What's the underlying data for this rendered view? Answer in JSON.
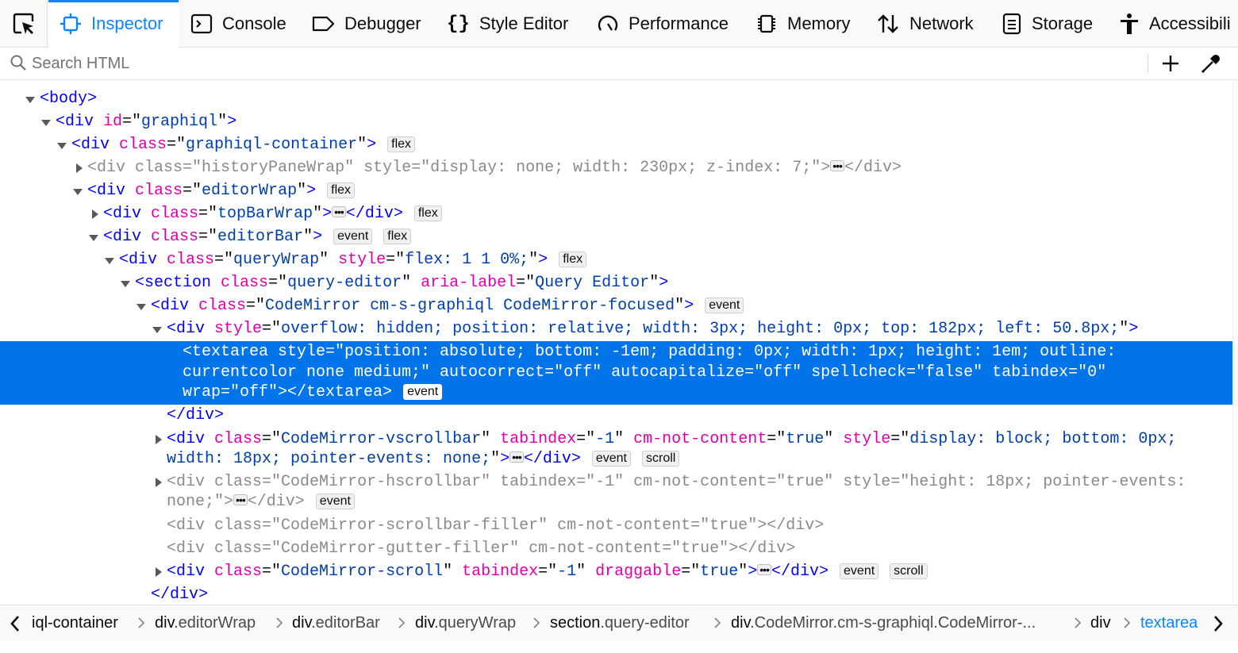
{
  "toolbar": {
    "tabs": [
      {
        "label": "Inspector",
        "icon": "inspector-icon"
      },
      {
        "label": "Console",
        "icon": "console-icon"
      },
      {
        "label": "Debugger",
        "icon": "debugger-icon"
      },
      {
        "label": "Style Editor",
        "icon": "style-editor-icon"
      },
      {
        "label": "Performance",
        "icon": "performance-icon"
      },
      {
        "label": "Memory",
        "icon": "memory-icon"
      },
      {
        "label": "Network",
        "icon": "network-icon"
      },
      {
        "label": "Storage",
        "icon": "storage-icon"
      },
      {
        "label": "Accessibili",
        "icon": "accessibility-icon"
      }
    ],
    "accent": "#0a84ff"
  },
  "search": {
    "placeholder": "Search HTML"
  },
  "tree": {
    "selection_color": "#0074e8",
    "lines": [
      {
        "segments": [
          [
            "tg",
            "<body>"
          ]
        ]
      },
      {
        "segments": [
          [
            "tg",
            "<div "
          ],
          [
            "an",
            "id"
          ],
          [
            "tx",
            "=\""
          ],
          [
            "av",
            "graphiql"
          ],
          [
            "tx",
            "\""
          ],
          [
            "tg",
            ">"
          ]
        ]
      },
      {
        "segments": [
          [
            "tg",
            "<div "
          ],
          [
            "an",
            "class"
          ],
          [
            "tx",
            "=\""
          ],
          [
            "av",
            "graphiql-container"
          ],
          [
            "tx",
            "\""
          ],
          [
            "tg",
            ">"
          ]
        ],
        "badges": [
          "flex"
        ]
      },
      {
        "segments": [
          [
            "tg",
            "<div "
          ],
          [
            "an",
            "class"
          ],
          [
            "tx",
            "=\""
          ],
          [
            "av",
            "historyPaneWrap"
          ],
          [
            "tx",
            "\" "
          ],
          [
            "an",
            "style"
          ],
          [
            "tx",
            "=\""
          ],
          [
            "av",
            "display: none; width: 230px; z-index: 7;"
          ],
          [
            "tx",
            "\""
          ],
          [
            "tg",
            ">"
          ]
        ],
        "tail": "</div>"
      },
      {
        "segments": [
          [
            "tg",
            "<div "
          ],
          [
            "an",
            "class"
          ],
          [
            "tx",
            "=\""
          ],
          [
            "av",
            "editorWrap"
          ],
          [
            "tx",
            "\""
          ],
          [
            "tg",
            ">"
          ]
        ],
        "badges": [
          "flex"
        ]
      },
      {
        "segments": [
          [
            "tg",
            "<div "
          ],
          [
            "an",
            "class"
          ],
          [
            "tx",
            "=\""
          ],
          [
            "av",
            "topBarWrap"
          ],
          [
            "tx",
            "\""
          ],
          [
            "tg",
            ">"
          ]
        ],
        "tail": "</div>",
        "badges": [
          "flex"
        ]
      },
      {
        "segments": [
          [
            "tg",
            "<div "
          ],
          [
            "an",
            "class"
          ],
          [
            "tx",
            "=\""
          ],
          [
            "av",
            "editorBar"
          ],
          [
            "tx",
            "\""
          ],
          [
            "tg",
            ">"
          ]
        ],
        "badges": [
          "event",
          "flex"
        ]
      },
      {
        "segments": [
          [
            "tg",
            "<div "
          ],
          [
            "an",
            "class"
          ],
          [
            "tx",
            "=\""
          ],
          [
            "av",
            "queryWrap"
          ],
          [
            "tx",
            "\" "
          ],
          [
            "an",
            "style"
          ],
          [
            "tx",
            "=\""
          ],
          [
            "av",
            "flex: 1 1 0%;"
          ],
          [
            "tx",
            "\""
          ],
          [
            "tg",
            ">"
          ]
        ],
        "badges": [
          "flex"
        ]
      },
      {
        "segments": [
          [
            "tg",
            "<section "
          ],
          [
            "an",
            "class"
          ],
          [
            "tx",
            "=\""
          ],
          [
            "av",
            "query-editor"
          ],
          [
            "tx",
            "\" "
          ],
          [
            "an",
            "aria-label"
          ],
          [
            "tx",
            "=\""
          ],
          [
            "av",
            "Query Editor"
          ],
          [
            "tx",
            "\""
          ],
          [
            "tg",
            ">"
          ]
        ]
      },
      {
        "segments": [
          [
            "tg",
            "<div "
          ],
          [
            "an",
            "class"
          ],
          [
            "tx",
            "=\""
          ],
          [
            "av",
            "CodeMirror cm-s-graphiql CodeMirror-focused"
          ],
          [
            "tx",
            "\""
          ],
          [
            "tg",
            ">"
          ]
        ],
        "badges": [
          "event"
        ]
      },
      {
        "segments": [
          [
            "tg",
            "<div "
          ],
          [
            "an",
            "style"
          ],
          [
            "tx",
            "=\""
          ],
          [
            "av",
            "overflow: hidden; position: relative; width: 3px; height: 0px; top: 182px; left: 50.8px;"
          ],
          [
            "tx",
            "\""
          ],
          [
            "tg",
            ">"
          ]
        ]
      },
      {
        "lines": [
          "<textarea style=\"position: absolute; bottom: -1em; padding: 0px; width: 1px; height: 1em; outline:",
          "currentcolor none medium;\" autocorrect=\"off\" autocapitalize=\"off\" spellcheck=\"false\" tabindex=\"0\"",
          "wrap=\"off\"></textarea>"
        ],
        "badges": [
          "event"
        ]
      },
      {
        "segments": [
          [
            "tg",
            "</div>"
          ]
        ]
      },
      {
        "segments": [
          [
            "tg",
            "<div "
          ],
          [
            "an",
            "class"
          ],
          [
            "tx",
            "=\""
          ],
          [
            "av",
            "CodeMirror-vscrollbar"
          ],
          [
            "tx",
            "\" "
          ],
          [
            "an",
            "tabindex"
          ],
          [
            "tx",
            "=\""
          ],
          [
            "av",
            "-1"
          ],
          [
            "tx",
            "\" "
          ],
          [
            "an",
            "cm-not-content"
          ],
          [
            "tx",
            "=\""
          ],
          [
            "av",
            "true"
          ],
          [
            "tx",
            "\" "
          ],
          [
            "an",
            "style"
          ],
          [
            "tx",
            "=\""
          ],
          [
            "av",
            "display: block; bottom: 0px;"
          ]
        ],
        "segments2": [
          [
            "av",
            "width: 18px; pointer-events: none;"
          ],
          [
            "tx",
            "\""
          ],
          [
            "tg",
            ">"
          ]
        ],
        "tail": "</div>",
        "badges": [
          "event",
          "scroll"
        ]
      },
      {
        "segments": [
          [
            "tg",
            "<div "
          ],
          [
            "an",
            "class"
          ],
          [
            "tx",
            "=\""
          ],
          [
            "av",
            "CodeMirror-hscrollbar"
          ],
          [
            "tx",
            "\" "
          ],
          [
            "an",
            "tabindex"
          ],
          [
            "tx",
            "=\""
          ],
          [
            "av",
            "-1"
          ],
          [
            "tx",
            "\" "
          ],
          [
            "an",
            "cm-not-content"
          ],
          [
            "tx",
            "=\""
          ],
          [
            "av",
            "true"
          ],
          [
            "tx",
            "\" "
          ],
          [
            "an",
            "style"
          ],
          [
            "tx",
            "=\""
          ],
          [
            "av",
            "height: 18px; pointer-events:"
          ]
        ],
        "segments2": [
          [
            "av",
            "none;"
          ],
          [
            "tx",
            "\""
          ],
          [
            "tg",
            ">"
          ]
        ],
        "tail": "</div>",
        "badges": [
          "event"
        ]
      },
      {
        "segments": [
          [
            "tg",
            "<div "
          ],
          [
            "an",
            "class"
          ],
          [
            "tx",
            "=\""
          ],
          [
            "av",
            "CodeMirror-scrollbar-filler"
          ],
          [
            "tx",
            "\" "
          ],
          [
            "an",
            "cm-not-content"
          ],
          [
            "tx",
            "=\""
          ],
          [
            "av",
            "true"
          ],
          [
            "tx",
            "\""
          ],
          [
            "tg",
            "></div>"
          ]
        ]
      },
      {
        "segments": [
          [
            "tg",
            "<div "
          ],
          [
            "an",
            "class"
          ],
          [
            "tx",
            "=\""
          ],
          [
            "av",
            "CodeMirror-gutter-filler"
          ],
          [
            "tx",
            "\" "
          ],
          [
            "an",
            "cm-not-content"
          ],
          [
            "tx",
            "=\""
          ],
          [
            "av",
            "true"
          ],
          [
            "tx",
            "\""
          ],
          [
            "tg",
            "></div>"
          ]
        ]
      },
      {
        "segments": [
          [
            "tg",
            "<div "
          ],
          [
            "an",
            "class"
          ],
          [
            "tx",
            "=\""
          ],
          [
            "av",
            "CodeMirror-scroll"
          ],
          [
            "tx",
            "\" "
          ],
          [
            "an",
            "tabindex"
          ],
          [
            "tx",
            "=\""
          ],
          [
            "av",
            "-1"
          ],
          [
            "tx",
            "\" "
          ],
          [
            "an",
            "draggable"
          ],
          [
            "tx",
            "=\""
          ],
          [
            "av",
            "true"
          ],
          [
            "tx",
            "\""
          ],
          [
            "tg",
            ">"
          ]
        ],
        "tail": "</div>",
        "badges": [
          "event",
          "scroll"
        ]
      },
      {
        "segments": [
          [
            "tg",
            "</div>"
          ]
        ]
      }
    ]
  },
  "breadcrumbs": [
    {
      "tag": "iql-container",
      "cls": ""
    },
    {
      "tag": "div",
      "cls": ".editorWrap"
    },
    {
      "tag": "div",
      "cls": ".editorBar"
    },
    {
      "tag": "div",
      "cls": ".queryWrap"
    },
    {
      "tag": "section",
      "cls": ".query-editor"
    },
    {
      "tag": "div",
      "cls": ".CodeMirror.cm-s-graphiql.CodeMirror-..."
    },
    {
      "tag": "div",
      "cls": ""
    },
    {
      "tag": "textarea",
      "cls": ""
    }
  ]
}
